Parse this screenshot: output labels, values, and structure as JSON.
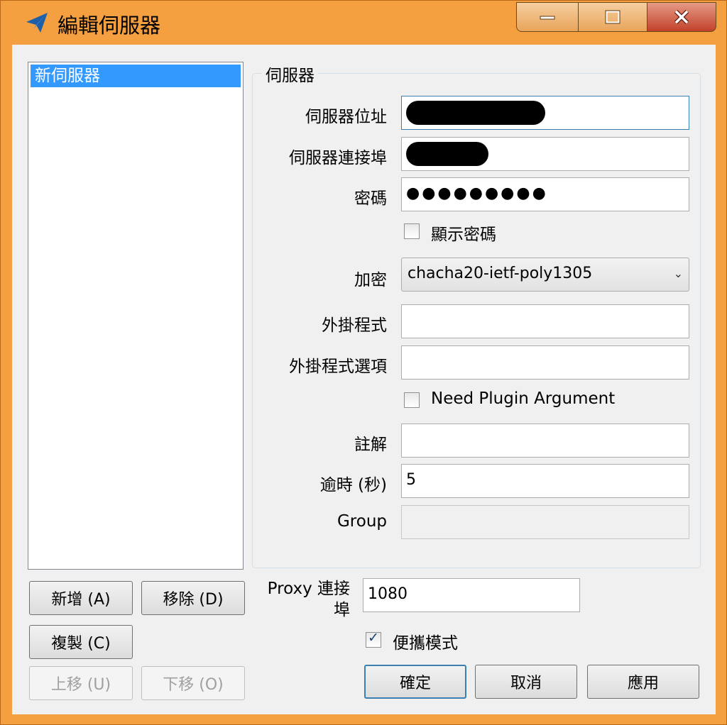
{
  "window": {
    "title": "編輯伺服器",
    "icon": "paper-plane-icon"
  },
  "controls": {
    "minimize": "minimize-icon",
    "maximize": "maximize-icon",
    "close": "close-icon"
  },
  "server_list": {
    "items": [
      "新伺服器"
    ],
    "selected_index": 0
  },
  "list_buttons": {
    "add": "新增 (A)",
    "remove": "移除 (D)",
    "duplicate": "複製 (C)",
    "move_up": "上移 (U)",
    "move_down": "下移 (O)"
  },
  "server_group": {
    "legend": "伺服器",
    "address_label": "伺服器位址",
    "port_label": "伺服器連接埠",
    "password_label": "密碼",
    "password_value": "●●●●●●●●●",
    "show_password_label": "顯示密碼",
    "encryption_label": "加密",
    "encryption_value": "chacha20-ietf-poly1305",
    "plugin_label": "外掛程式",
    "plugin_value": "",
    "plugin_options_label": "外掛程式選項",
    "plugin_options_value": "",
    "need_plugin_arg_label": "Need Plugin Argument",
    "remarks_label": "註解",
    "remarks_value": "",
    "timeout_label": "逾時 (秒)",
    "timeout_value": "5",
    "group_label": "Group",
    "group_value": ""
  },
  "proxy": {
    "port_label_line1": "Proxy 連接",
    "port_label_line2": "埠",
    "port_value": "1080"
  },
  "portable": {
    "label": "便攜模式",
    "checked": true
  },
  "dialog_buttons": {
    "ok": "確定",
    "cancel": "取消",
    "apply": "應用"
  },
  "colors": {
    "title_bar": "#f4a041",
    "selection": "#3399ff",
    "client_bg": "#f0f0f0"
  }
}
